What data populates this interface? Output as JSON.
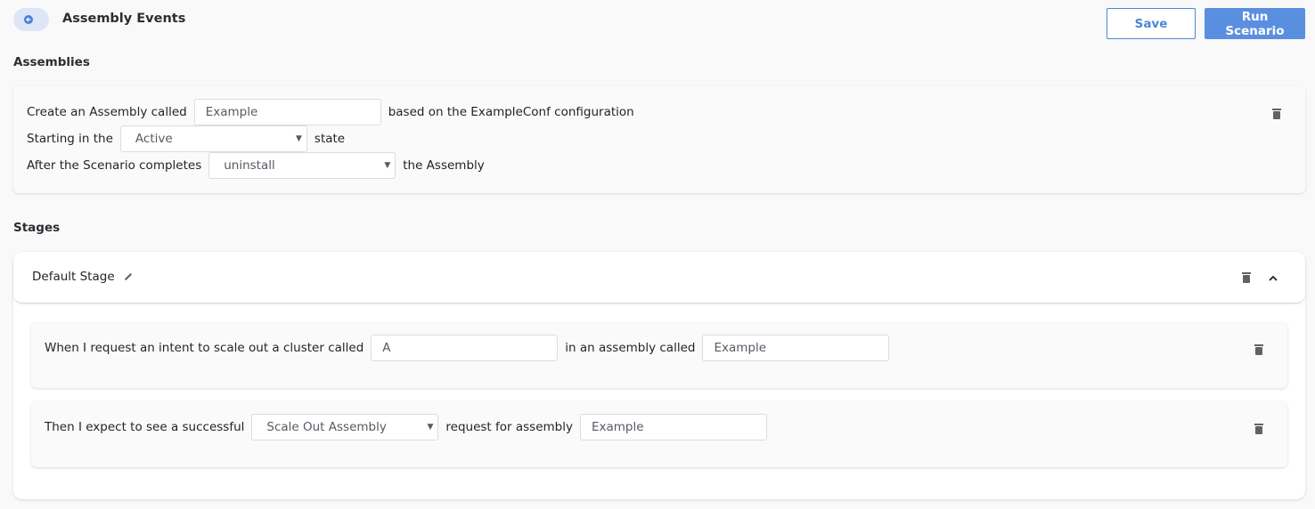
{
  "header": {
    "back_icon": "arrow-left-circle-icon",
    "title": "Assembly Events",
    "save_label": "Save",
    "run_label": "Run Scenario"
  },
  "assemblies": {
    "section_title": "Assemblies",
    "row1": {
      "prefix": "Create an Assembly called",
      "name_value": "Example",
      "suffix": "based on the ExampleConf configuration"
    },
    "row2": {
      "prefix": "Starting in the",
      "state_value": "Active",
      "suffix": "state"
    },
    "row3": {
      "prefix": "After the Scenario completes",
      "action_value": "uninstall",
      "suffix": "the Assembly"
    },
    "delete_icon": "trash-icon"
  },
  "stages": {
    "section_title": "Stages",
    "items": [
      {
        "name": "Default Stage",
        "edit_icon": "pencil-icon",
        "delete_icon": "trash-icon",
        "collapse_icon": "chevron-up-icon",
        "steps": [
          {
            "prefix": "When I request an intent to scale out a cluster called",
            "cluster_value": "A",
            "middle": "in an assembly called",
            "assembly_value": "Example",
            "delete_icon": "trash-icon"
          },
          {
            "prefix": "Then I expect to see a successful",
            "request_type_value": "Scale Out Assembly",
            "middle": "request for assembly",
            "assembly_value": "Example",
            "delete_icon": "trash-icon"
          }
        ]
      }
    ]
  }
}
